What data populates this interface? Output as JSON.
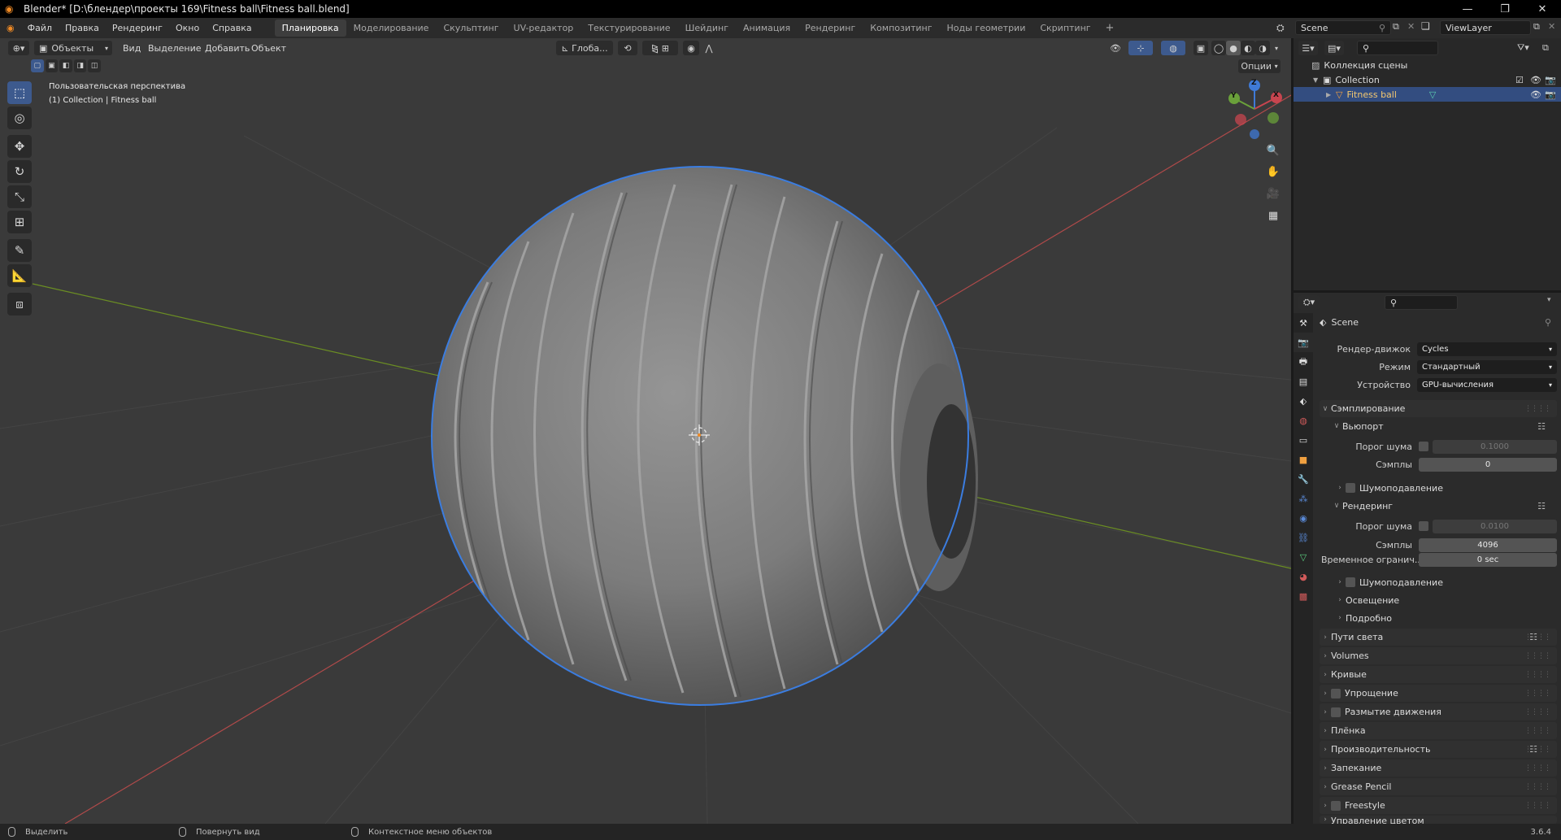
{
  "window": {
    "title": "Blender* [D:\\блендер\\проекты 169\\Fitness ball\\Fitness ball.blend]",
    "controls": [
      "—",
      "❐",
      "✕"
    ]
  },
  "menu": [
    "Файл",
    "Правка",
    "Рендеринг",
    "Окно",
    "Справка"
  ],
  "workspaces": {
    "tabs": [
      "Планировка",
      "Моделирование",
      "Скульптинг",
      "UV-редактор",
      "Текстурирование",
      "Шейдинг",
      "Анимация",
      "Рендеринг",
      "Композитинг",
      "Ноды геометрии",
      "Скриптинг"
    ],
    "active_index": 0,
    "add": "+"
  },
  "scene": {
    "name": "Scene",
    "view_layer": "ViewLayer"
  },
  "viewport": {
    "mode": "Объекты",
    "menus": [
      "Вид",
      "Выделение",
      "Добавить",
      "Объект"
    ],
    "transform_orientation": "Глоба...",
    "options": "Опции",
    "perspective_label": "Пользовательская перспектива",
    "object_label": "(1) Collection | Fitness ball",
    "gizmo_axes": [
      "X",
      "Y",
      "Z"
    ],
    "colors": {
      "x_axis": "#b04a4a",
      "y_axis": "#6b8e23",
      "selection": "#3b7de0",
      "ball": "#8a8a8a"
    }
  },
  "outliner": {
    "root": "Коллекция сцены",
    "collection": "Collection",
    "object": "Fitness ball"
  },
  "properties": {
    "context": "Scene",
    "render_engine_label": "Рендер-движок",
    "render_engine": "Cycles",
    "mode_label": "Режим",
    "mode": "Стандартный",
    "device_label": "Устройство",
    "device": "GPU-вычисления",
    "sampling": "Сэмплирование",
    "viewport_section": "Вьюпорт",
    "noise_threshold_label": "Порог шума",
    "viewport_noise_threshold": "0.1000",
    "samples_label": "Сэмплы",
    "viewport_samples": "0",
    "denoising": "Шумоподавление",
    "render_section": "Рендеринг",
    "render_noise_threshold": "0.0100",
    "render_samples": "4096",
    "time_limit_label": "Временное огранич...",
    "time_limit": "0 sec",
    "lights": "Освещение",
    "advanced": "Подробно",
    "panels": [
      "Пути света",
      "Volumes",
      "Кривые",
      "Упрощение",
      "Размытие движения",
      "Плёнка",
      "Производительность",
      "Запекание",
      "Grease Pencil",
      "Freestyle",
      "Управление цветом"
    ]
  },
  "status": {
    "select": "Выделить",
    "rotate": "Повернуть вид",
    "context_menu": "Контекстное меню объектов",
    "version": "3.6.4"
  }
}
